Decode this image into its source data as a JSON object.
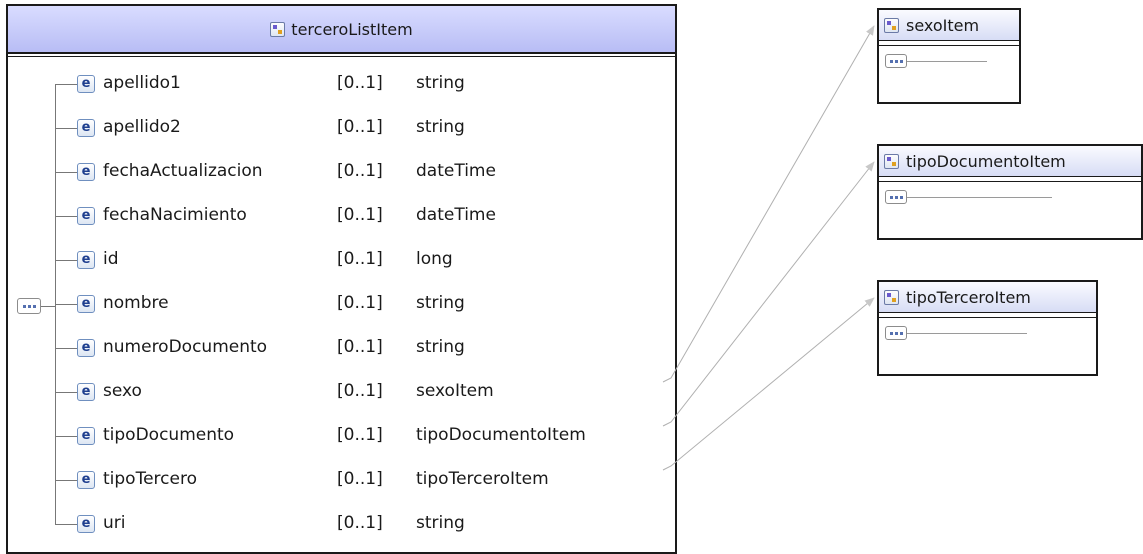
{
  "main": {
    "title": "terceroListItem",
    "elements": [
      {
        "name": "apellido1",
        "card": "[0..1]",
        "type": "string"
      },
      {
        "name": "apellido2",
        "card": "[0..1]",
        "type": "string"
      },
      {
        "name": "fechaActualizacion",
        "card": "[0..1]",
        "type": "dateTime"
      },
      {
        "name": "fechaNacimiento",
        "card": "[0..1]",
        "type": "dateTime"
      },
      {
        "name": "id",
        "card": "[0..1]",
        "type": "long"
      },
      {
        "name": "nombre",
        "card": "[0..1]",
        "type": "string"
      },
      {
        "name": "numeroDocumento",
        "card": "[0..1]",
        "type": "string"
      },
      {
        "name": "sexo",
        "card": "[0..1]",
        "type": "sexoItem"
      },
      {
        "name": "tipoDocumento",
        "card": "[0..1]",
        "type": "tipoDocumentoItem"
      },
      {
        "name": "tipoTercero",
        "card": "[0..1]",
        "type": "tipoTerceroItem"
      },
      {
        "name": "uri",
        "card": "[0..1]",
        "type": "string"
      }
    ],
    "element_badge": "e"
  },
  "refs": [
    {
      "title": "sexoItem"
    },
    {
      "title": "tipoDocumentoItem"
    },
    {
      "title": "tipoTerceroItem"
    }
  ],
  "icons": {
    "complex_type": "complex-type-icon",
    "element": "element-icon",
    "sequence": "sequence-icon"
  },
  "colors": {
    "header_gradient_top": "#d9dcff",
    "header_gradient_bottom": "#b8bdf5",
    "element_badge_text": "#1f3f8f",
    "link_line": "#b0b0b0"
  }
}
